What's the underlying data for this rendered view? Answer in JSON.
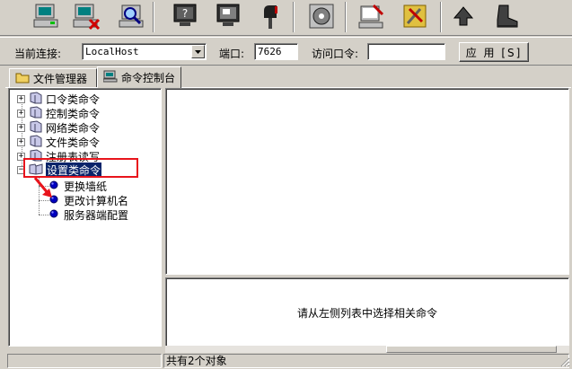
{
  "toolbar": {
    "buttons": [
      {
        "name": "computer-green-icon"
      },
      {
        "name": "computer-red-x-icon"
      },
      {
        "name": "magnifier-computer-icon"
      },
      {
        "name": "monitor-question-icon"
      },
      {
        "name": "monitor-screen-icon"
      },
      {
        "name": "mailbox-icon"
      },
      {
        "name": "disk-settings-icon"
      },
      {
        "name": "notepad-pen-icon"
      },
      {
        "name": "tools-icon"
      },
      {
        "name": "arrow-up-icon"
      },
      {
        "name": "boot-icon"
      }
    ]
  },
  "connection": {
    "current_label": "当前连接:",
    "current_value": "LocalHost",
    "port_label": "端口:",
    "port_value": "7626",
    "password_label": "访问口令:",
    "password_value": "",
    "apply_label": "应 用 [S]"
  },
  "tabs": [
    {
      "label": "文件管理器",
      "icon": "folder-icon"
    },
    {
      "label": "命令控制台",
      "icon": "computer-console-icon"
    }
  ],
  "tree": {
    "categories": [
      {
        "label": "口令类命令"
      },
      {
        "label": "控制类命令"
      },
      {
        "label": "网络类命令"
      },
      {
        "label": "文件类命令"
      },
      {
        "label": "注册表读写"
      },
      {
        "label": "设置类命令"
      }
    ],
    "children": [
      {
        "label": "更换墙纸"
      },
      {
        "label": "更改计算机名"
      },
      {
        "label": "服务器端配置"
      }
    ]
  },
  "detail": {
    "hint": "请从左侧列表中选择相关命令"
  },
  "status": {
    "count_text": "共有2个对象"
  },
  "colors": {
    "window_bg": "#d4d0c8",
    "selection": "#0a246a",
    "annotation_red": "#e8141c"
  }
}
